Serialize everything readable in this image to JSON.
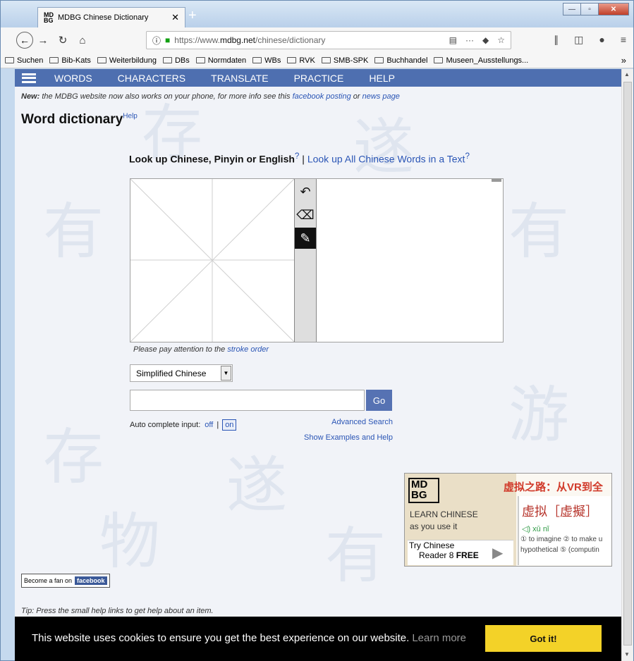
{
  "browser": {
    "tab_favicon": "MD\nBG",
    "tab_title": "MDBG Chinese Dictionary",
    "tab_close": "✕",
    "new_tab": "+",
    "url_prefix": "https://www.",
    "url_domain": "mdbg.net",
    "url_path": "/chinese/dictionary",
    "url_more": "···",
    "window_controls": [
      "—",
      "▫",
      "✕"
    ]
  },
  "bookmarks": [
    "Suchen",
    "Bib-Kats",
    "Weiterbildung",
    "DBs",
    "Normdaten",
    "WBs",
    "RVK",
    "SMB-SPK",
    "Buchhandel",
    "Museen_Ausstellungs..."
  ],
  "bookmarks_more": "»",
  "menu": [
    "WORDS",
    "CHARACTERS",
    "TRANSLATE",
    "PRACTICE",
    "HELP"
  ],
  "notice": {
    "new_label": "New:",
    "text1": " the MDBG website now also works on your phone, for more info see this ",
    "link1": "facebook posting",
    "text2": " or ",
    "link2": "news page"
  },
  "heading": {
    "title": "Word dictionary",
    "help": "Help"
  },
  "lookup": {
    "label": "Look up Chinese, Pinyin or English",
    "q": "?",
    "sep": " | ",
    "link": "Look up All Chinese Words in a Text"
  },
  "stroke_order": {
    "text": "Please pay attention to the ",
    "link": "stroke order"
  },
  "script_select": {
    "value": "Simplified Chinese",
    "arrow": "▼"
  },
  "search": {
    "placeholder": "",
    "go": "Go"
  },
  "autocomplete": {
    "label": "Auto complete input:",
    "off": "off",
    "sep": "|",
    "on": "on"
  },
  "advanced_search": "Advanced Search",
  "show_examples": "Show Examples and Help",
  "ad": {
    "logo": "MD\nBG",
    "learn1": "LEARN CHINESE",
    "learn2": "as you use it",
    "try1": "Try Chinese",
    "try2": "Reader 8 ",
    "try_free": "FREE",
    "play": "▶",
    "headline": "虚拟之路：从VR到全",
    "word": "虚拟［虚擬］",
    "pinyin": "◁) xū nǐ",
    "def1": "① to imagine ② to make u",
    "def2": "hypothetical ⑤ (computin"
  },
  "fan": {
    "text": "Become a fan on",
    "fb": "facebook"
  },
  "tip": "Tip: Press the small help links to get help about an item.",
  "cookie": {
    "message": "This website uses cookies to ensure you get the best experience on our website.",
    "learn": "Learn more",
    "button": "Got it!"
  },
  "colors": {
    "menu_bg": "#4e6fb0",
    "link": "#2a55b5",
    "go_button": "#5672b3",
    "cookie_button": "#f3d228",
    "ad_headline": "#d13b2b"
  }
}
